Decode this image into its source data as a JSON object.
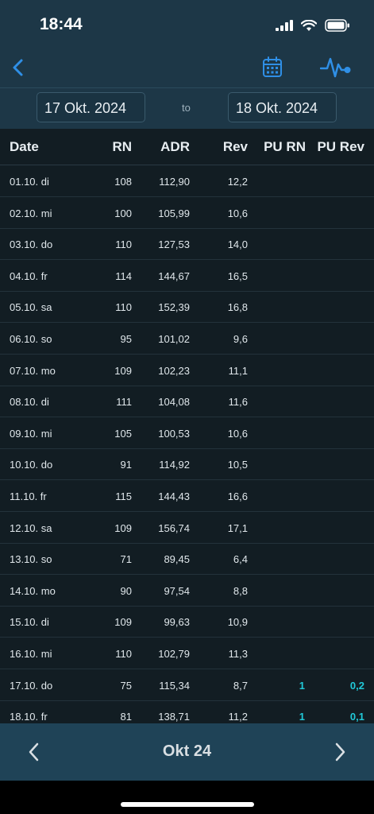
{
  "status": {
    "time": "18:44"
  },
  "dates": {
    "from": "17 Okt. 2024",
    "separator": "to",
    "to": "18 Okt. 2024"
  },
  "columns": {
    "date": "Date",
    "rn": "RN",
    "adr": "ADR",
    "rev": "Rev",
    "pu_rn": "PU RN",
    "pu_rev": "PU Rev"
  },
  "rows": [
    {
      "date": "01.10. di",
      "rn": "108",
      "adr": "112,90",
      "rev": "12,2",
      "pu_rn": "",
      "pu_rev": ""
    },
    {
      "date": "02.10. mi",
      "rn": "100",
      "adr": "105,99",
      "rev": "10,6",
      "pu_rn": "",
      "pu_rev": ""
    },
    {
      "date": "03.10. do",
      "rn": "110",
      "adr": "127,53",
      "rev": "14,0",
      "pu_rn": "",
      "pu_rev": ""
    },
    {
      "date": "04.10. fr",
      "rn": "114",
      "adr": "144,67",
      "rev": "16,5",
      "pu_rn": "",
      "pu_rev": ""
    },
    {
      "date": "05.10. sa",
      "rn": "110",
      "adr": "152,39",
      "rev": "16,8",
      "pu_rn": "",
      "pu_rev": ""
    },
    {
      "date": "06.10. so",
      "rn": "95",
      "adr": "101,02",
      "rev": "9,6",
      "pu_rn": "",
      "pu_rev": ""
    },
    {
      "date": "07.10. mo",
      "rn": "109",
      "adr": "102,23",
      "rev": "11,1",
      "pu_rn": "",
      "pu_rev": ""
    },
    {
      "date": "08.10. di",
      "rn": "111",
      "adr": "104,08",
      "rev": "11,6",
      "pu_rn": "",
      "pu_rev": ""
    },
    {
      "date": "09.10. mi",
      "rn": "105",
      "adr": "100,53",
      "rev": "10,6",
      "pu_rn": "",
      "pu_rev": ""
    },
    {
      "date": "10.10. do",
      "rn": "91",
      "adr": "114,92",
      "rev": "10,5",
      "pu_rn": "",
      "pu_rev": ""
    },
    {
      "date": "11.10. fr",
      "rn": "115",
      "adr": "144,43",
      "rev": "16,6",
      "pu_rn": "",
      "pu_rev": ""
    },
    {
      "date": "12.10. sa",
      "rn": "109",
      "adr": "156,74",
      "rev": "17,1",
      "pu_rn": "",
      "pu_rev": ""
    },
    {
      "date": "13.10. so",
      "rn": "71",
      "adr": "89,45",
      "rev": "6,4",
      "pu_rn": "",
      "pu_rev": ""
    },
    {
      "date": "14.10. mo",
      "rn": "90",
      "adr": "97,54",
      "rev": "8,8",
      "pu_rn": "",
      "pu_rev": ""
    },
    {
      "date": "15.10. di",
      "rn": "109",
      "adr": "99,63",
      "rev": "10,9",
      "pu_rn": "",
      "pu_rev": ""
    },
    {
      "date": "16.10. mi",
      "rn": "110",
      "adr": "102,79",
      "rev": "11,3",
      "pu_rn": "",
      "pu_rev": ""
    },
    {
      "date": "17.10. do",
      "rn": "75",
      "adr": "115,34",
      "rev": "8,7",
      "pu_rn": "1",
      "pu_rev": "0,2"
    },
    {
      "date": "18.10. fr",
      "rn": "81",
      "adr": "138,71",
      "rev": "11,2",
      "pu_rn": "1",
      "pu_rev": "0,1"
    }
  ],
  "footer": {
    "month": "Okt 24"
  },
  "icons": {
    "back": "chevron-left-icon",
    "calendar": "calendar-icon",
    "pulse": "pulse-icon",
    "prev": "chevron-left-icon",
    "next": "chevron-right-icon"
  },
  "colors": {
    "accent": "#2f8fe6",
    "highlight": "#21c9d8",
    "header_bg": "#1d3747",
    "footer_bg": "#1f4357",
    "body_bg": "#121d23"
  }
}
